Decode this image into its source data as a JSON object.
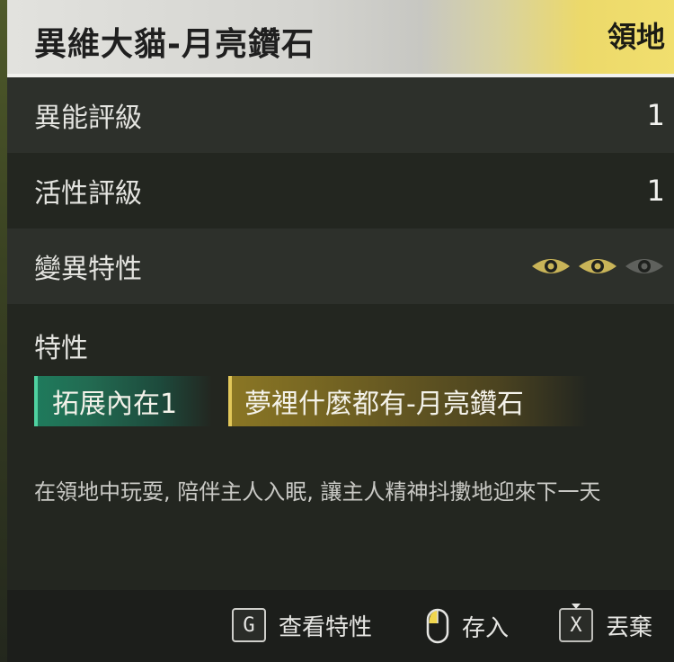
{
  "header": {
    "title": "異維大貓-月亮鑽石",
    "tag": "領地"
  },
  "stats": [
    {
      "label": "異能評級",
      "value": "1"
    },
    {
      "label": "活性評級",
      "value": "1"
    },
    {
      "label": "變異特性",
      "mutation_level": 2,
      "mutation_max": 3
    }
  ],
  "traits": {
    "heading": "特性",
    "tags": [
      {
        "label": "拓展內在1",
        "color": "#1f7a5c"
      },
      {
        "label": "夢裡什麼都有-月亮鑽石",
        "color": "#8a7624"
      }
    ],
    "description": "在領地中玩耍, 陪伴主人入眠, 讓主人精神抖擻地迎來下一天"
  },
  "footer": {
    "view_traits": {
      "key": "G",
      "label": "查看特性",
      "icon": "keycap-g-icon"
    },
    "store": {
      "label": "存入",
      "icon": "mouse-left-click-icon"
    },
    "discard": {
      "key": "X",
      "label": "丟棄",
      "icon": "keycap-x-icon"
    }
  },
  "colors": {
    "accent_gold": "#e8d25c",
    "eye_active": "#c9b458",
    "eye_inactive": "#5f615d"
  }
}
